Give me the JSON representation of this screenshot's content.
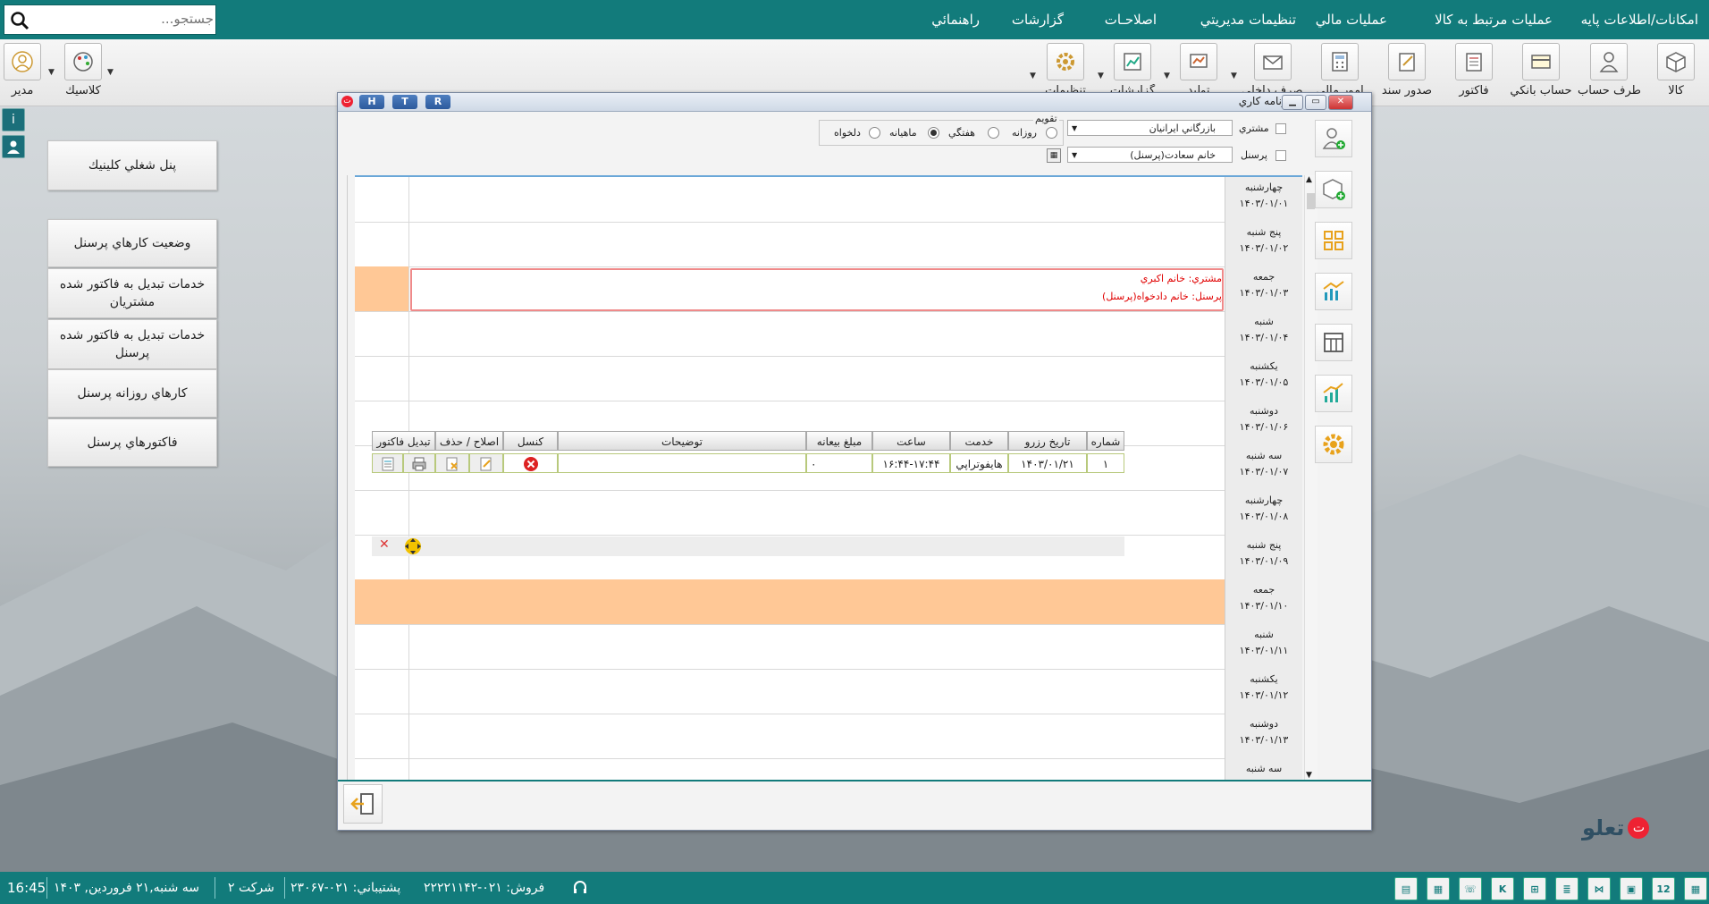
{
  "menu": {
    "items": [
      "امكانات/اطلاعات پايه",
      "عمليات مرتبط به كالا",
      "عمليات مالي",
      "تنظيمات مديريتي",
      "اصلاحـات",
      "گزارشات",
      "راهنمائي"
    ],
    "search_placeholder": "جستجو..."
  },
  "toolbar": {
    "items": [
      {
        "label": "كالا",
        "icon": "box-icon"
      },
      {
        "label": "طرف حساب",
        "icon": "person-icon"
      },
      {
        "label": "حساب بانكي",
        "icon": "bank-card-icon"
      },
      {
        "label": "فاكتور",
        "icon": "invoice-icon"
      },
      {
        "label": "صدور سند",
        "icon": "voucher-icon"
      },
      {
        "label": "امور مالي",
        "icon": "calculator-icon"
      },
      {
        "label": "مصرف داخلي",
        "icon": "envelope-icon"
      },
      {
        "label": "توليد",
        "icon": "production-icon"
      },
      {
        "label": "گزارشات",
        "icon": "report-icon"
      },
      {
        "label": "تنظيمات",
        "icon": "gear-icon"
      }
    ],
    "theme_label": "كلاسيك",
    "user_label": "مدير"
  },
  "left_panel": {
    "buttons": [
      "پنل شغلي كلينيك",
      "وضعيت كارهاي پرسنل",
      "خدمات تبديل به فاكتور شده مشتريان",
      "خدمات تبديل به فاكتور شده پرسنل",
      "كارهاي روزانه پرسنل",
      "فاكتورهاي پرسنل"
    ]
  },
  "window": {
    "title": "برنامه كاري",
    "h_button": "H",
    "t_button": "T",
    "r_button": "R"
  },
  "filters": {
    "customer_label": "مشتري",
    "customer_value": "بازرگاني ايرانيان",
    "personnel_label": "پرسنل",
    "personnel_value": "خانم سعادت(پرسنل)",
    "calendar_label": "تقويم",
    "calendar_options": [
      "روزانه",
      "هفتگي",
      "ماهيانه",
      "دلخواه"
    ],
    "calendar_selected": "ماهيانه"
  },
  "schedule": {
    "days": [
      {
        "name": "چهارشنبه",
        "date": "۱۴۰۳/۰۱/۰۱"
      },
      {
        "name": "پنج شنبه",
        "date": "۱۴۰۳/۰۱/۰۲"
      },
      {
        "name": "جمعه",
        "date": "۱۴۰۳/۰۱/۰۳"
      },
      {
        "name": "شنبه",
        "date": "۱۴۰۳/۰۱/۰۴"
      },
      {
        "name": "يكشنبه",
        "date": "۱۴۰۳/۰۱/۰۵"
      },
      {
        "name": "دوشنبه",
        "date": "۱۴۰۳/۰۱/۰۶"
      },
      {
        "name": "سه شنبه",
        "date": "۱۴۰۳/۰۱/۰۷"
      },
      {
        "name": "چهارشنبه",
        "date": "۱۴۰۳/۰۱/۰۸"
      },
      {
        "name": "پنج شنبه",
        "date": "۱۴۰۳/۰۱/۰۹"
      },
      {
        "name": "جمعه",
        "date": "۱۴۰۳/۰۱/۱۰"
      },
      {
        "name": "شنبه",
        "date": "۱۴۰۳/۰۱/۱۱"
      },
      {
        "name": "يكشنبه",
        "date": "۱۴۰۳/۰۱/۱۲"
      },
      {
        "name": "دوشنبه",
        "date": "۱۴۰۳/۰۱/۱۳"
      },
      {
        "name": "سه شنبه",
        "date": ""
      }
    ],
    "event": {
      "customer_line": "مشتري: خانم اكبري",
      "personnel_line": "پرسنل: خانم دادخواه(پرسنل)"
    }
  },
  "detail_table": {
    "headers": [
      "شماره",
      "تاريخ رزرو",
      "خدمت",
      "ساعت",
      "مبلغ بيعانه",
      "توضيحات",
      "كنسل",
      "اصلاح / حذف",
      "تبديل فاكتور"
    ],
    "row": {
      "number": "۱",
      "reserve_date": "۱۴۰۳/۰۱/۲۱",
      "service": "هايفوتراپي",
      "time": "۱۶:۴۴-۱۷:۴۴",
      "deposit": "۰",
      "description": ""
    }
  },
  "status": {
    "datetime": "سه شنبه,۲۱ فروردين, ۱۴۰۳",
    "clock": "16:45",
    "company": "شركت ۲",
    "support": "پشتيباني: ۰۲۱-۲۳۰۶۷",
    "sales": "فروش: ۰۲۱-۲۲۲۲۱۱۴۲",
    "day_badge": "12"
  },
  "brand": {
    "logo_text": "تعلو"
  },
  "colors": {
    "teal": "#127b7b",
    "highlight": "#ffc896",
    "event_border": "#ef8a8a",
    "event_text": "#e00000"
  }
}
